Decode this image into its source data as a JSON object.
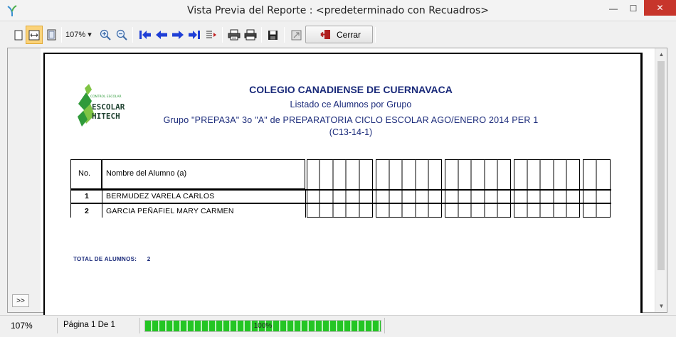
{
  "window": {
    "title": "Vista Previa del Reporte : <predeterminado con Recuadros>",
    "minimize_glyph": "—",
    "maximize_glyph": "☐",
    "close_glyph": "✕"
  },
  "toolbar": {
    "zoom_value": "107%",
    "close_label": "Cerrar",
    "icons": [
      "single-page-icon",
      "fit-width-icon",
      "full-page-icon",
      "zoom-in-icon",
      "zoom-out-icon",
      "first-page-icon",
      "previous-page-icon",
      "next-page-icon",
      "last-page-icon",
      "goto-page-icon",
      "print-setup-icon",
      "print-icon",
      "save-icon",
      "export-icon",
      "close-door-icon"
    ]
  },
  "report": {
    "logo_top_text": "CONTROL ESCOLAR",
    "logo_word1": "ESCOLAR",
    "logo_word2": "HITECH",
    "school": "COLEGIO CANADIENSE DE CUERNAVACA",
    "subtitle": "Listado ce Alumnos por Grupo",
    "group_line": "Grupo \"PREPA3A\" 3o \"A\" de  PREPARATORIA CICLO ESCOLAR AGO/ENERO 2014 PER 1",
    "code": "(C13-14-1)",
    "table": {
      "header_no": "No.",
      "header_name": "Nombre del Alumno (a)",
      "rows": [
        {
          "no": "1",
          "name": "BERMUDEZ VARELA CARLOS"
        },
        {
          "no": "2",
          "name": "GARCIA  PEÑAFIEL MARY CARMEN"
        }
      ]
    },
    "total_label": "TOTAL DE ALUMNOS:",
    "total_value": "2"
  },
  "side": {
    "expand_label": ">>"
  },
  "status": {
    "zoom": "107%",
    "page": "Página 1 De 1",
    "progress_label": "100%",
    "progress_fraction": 1.0
  },
  "colors": {
    "report_blue": "#1a2a7a",
    "progress_green": "#24c524",
    "close_red": "#c7352b",
    "active_button": "#fbd37a"
  }
}
